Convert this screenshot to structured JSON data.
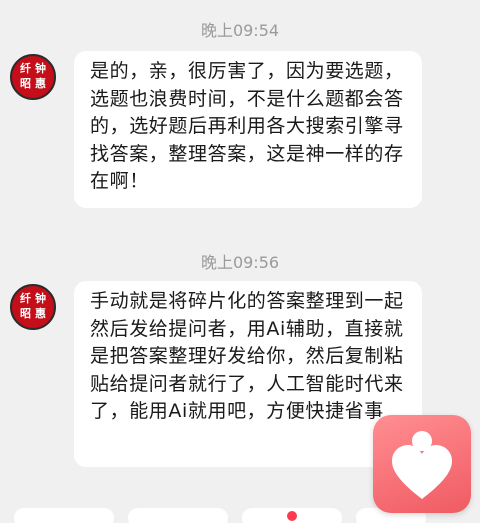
{
  "messages": [
    {
      "time": "晚上09:54",
      "avatar_text": [
        "纤",
        "钟",
        "昭",
        "惠"
      ],
      "text": "是的，亲，很厉害了，因为要选题，选题也浪费时间，不是什么题都会答的，选好题后再利用各大搜索引擎寻找答案，整理答案，这是神一样的存在啊！"
    },
    {
      "time": "晚上09:56",
      "avatar_text": [
        "纤",
        "钟",
        "昭",
        "惠"
      ],
      "text": "手动就是将碎片化的答案整理到一起然后发给提问者，用Ai辅助，直接就是把答案整理好发给你，然后复制粘贴给提问者就行了，人工智能时代来了，能用Ai就用吧，方便快捷省事"
    }
  ],
  "float_button": {
    "icon": "heart-person-icon",
    "color": "#f05a62"
  }
}
